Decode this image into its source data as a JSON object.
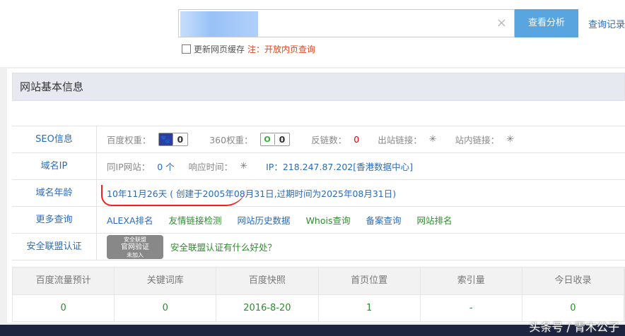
{
  "search": {
    "value": "",
    "clear_icon": "×",
    "button": "查看分析",
    "history": "查询记录"
  },
  "cache": {
    "label": "更新网页缓存",
    "note": "注：开放内页查询"
  },
  "panel": {
    "title": "网站基本信息"
  },
  "seo": {
    "label": "SEO信息",
    "baidu_label": "百度权重：",
    "baidu_value": "0",
    "w360_label": "360权重：",
    "w360_value": "0",
    "backlinks_label": "反链数：",
    "backlinks_value": "0",
    "outlinks_label": "出站链接：",
    "inlinks_label": "站内链接："
  },
  "ip": {
    "label": "域名IP",
    "same_ip_label": "同IP网站：",
    "same_ip_value": "0 个",
    "resp_label": "响应时间：",
    "ip_text": "IP：218.247.87.202[香港数据中心]"
  },
  "age": {
    "label": "域名年龄",
    "text": "10年11月26天 ( 创建于2005年08月31日,过期时间为2025年08月31日)"
  },
  "more": {
    "label": "更多查询",
    "links": [
      "ALEXA排名",
      "友情链接检测",
      "网站历史数据",
      "Whois查询",
      "备案查询",
      "网站排名"
    ]
  },
  "cert": {
    "label": "安全联盟认证",
    "seal_top": "安全联盟",
    "seal_mid": "官网验证",
    "seal_bot": "未加入",
    "link": "安全联盟认证有什么好处？"
  },
  "stats": {
    "headers": [
      "百度流量预计",
      "关键词库",
      "百度快照",
      "首页位置",
      "索引量",
      "今日收录"
    ],
    "values": [
      "0",
      "0",
      "2016-8-20",
      "1",
      "-",
      "0"
    ]
  },
  "watermark": "头条号 / 青木公子"
}
